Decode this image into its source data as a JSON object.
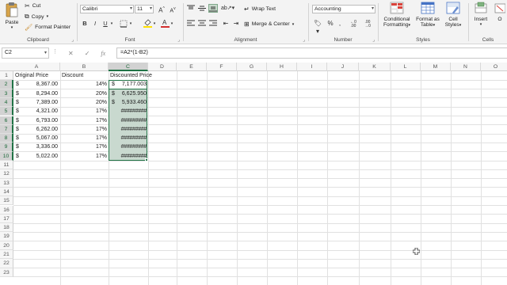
{
  "ribbon": {
    "clipboard": {
      "paste": "Paste",
      "cut": "Cut",
      "copy": "Copy",
      "format_painter": "Format Painter",
      "label": "Clipboard"
    },
    "font": {
      "font_name": "Calibri",
      "font_size": "11",
      "label": "Font"
    },
    "alignment": {
      "wrap_text": "Wrap Text",
      "merge_center": "Merge & Center",
      "label": "Alignment"
    },
    "number": {
      "format": "Accounting",
      "label": "Number"
    },
    "styles": {
      "conditional_formatting_1": "Conditional",
      "conditional_formatting_2": "Formatting",
      "format_as_table_1": "Format as",
      "format_as_table_2": "Table",
      "cell_styles_1": "Cell",
      "cell_styles_2": "Styles",
      "label": "Styles"
    },
    "cells": {
      "insert": "Insert",
      "other": "O",
      "label": "Cells"
    }
  },
  "formula_bar": {
    "name_box": "C2",
    "formula": "=A2*(1-B2)"
  },
  "columns": [
    "A",
    "B",
    "C",
    "D",
    "E",
    "F",
    "G",
    "H",
    "I",
    "J",
    "K",
    "L",
    "M",
    "N",
    "O"
  ],
  "rows": [
    "1",
    "2",
    "3",
    "4",
    "5",
    "6",
    "7",
    "8",
    "9",
    "10",
    "11",
    "12",
    "13",
    "14",
    "15",
    "16",
    "17",
    "18",
    "19",
    "20",
    "21",
    "22",
    "23"
  ],
  "sheet": {
    "headers": {
      "a": "Original Price",
      "b": "Discount",
      "c": "Discounted Price"
    },
    "currency_symbol": "$",
    "data": [
      {
        "price": "8,367.00",
        "discount": "14%",
        "result_symbol": "$",
        "result": "7,177.003"
      },
      {
        "price": "8,294.00",
        "discount": "20%",
        "result_symbol": "$",
        "result": "6,625.950"
      },
      {
        "price": "7,389.00",
        "discount": "20%",
        "result_symbol": "$",
        "result": "5,933.460"
      },
      {
        "price": "4,321.00",
        "discount": "17%",
        "result_symbol": "",
        "result": "#########"
      },
      {
        "price": "6,793.00",
        "discount": "17%",
        "result_symbol": "",
        "result": "#########"
      },
      {
        "price": "6,262.00",
        "discount": "17%",
        "result_symbol": "",
        "result": "#########"
      },
      {
        "price": "5,067.00",
        "discount": "17%",
        "result_symbol": "",
        "result": "#########"
      },
      {
        "price": "3,336.00",
        "discount": "17%",
        "result_symbol": "",
        "result": "#########"
      },
      {
        "price": "5,022.00",
        "discount": "17%",
        "result_symbol": "",
        "result": "#########"
      }
    ]
  },
  "icons": {
    "fx": "fx",
    "cancel": "✕",
    "confirm": "✓"
  },
  "colors": {
    "accent_green": "#217346",
    "selection_fill": "#c9d9cf",
    "ribbon_bg": "#f3f3f3"
  }
}
